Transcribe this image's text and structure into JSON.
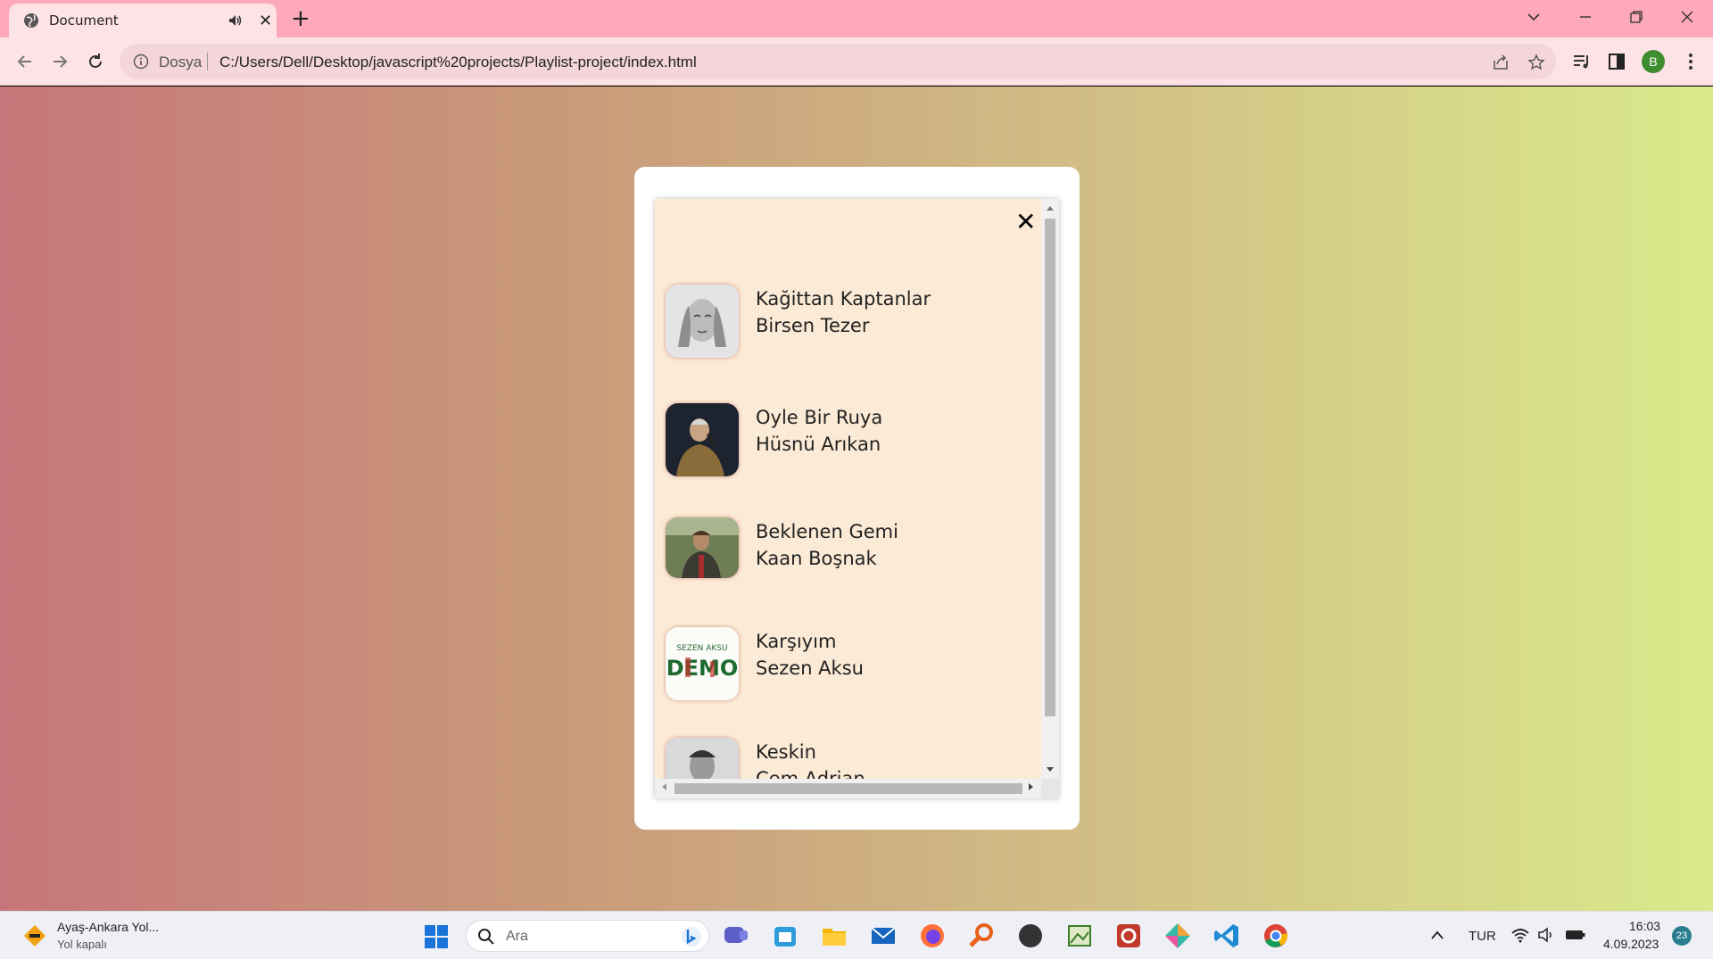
{
  "browser": {
    "tab_title": "Document",
    "new_tab": "+",
    "tab_close": "✕",
    "omnibox_label": "Dosya",
    "url": "C:/Users/Dell/Desktop/javascript%20projects/Playlist-project/index.html",
    "profile_initial": "B"
  },
  "playlist": {
    "close_label": "✕",
    "songs": [
      {
        "name": "Kağittan Kaptanlar",
        "artist": "Birsen Tezer"
      },
      {
        "name": "Oyle Bir Ruya",
        "artist": "Hüsnü Arıkan"
      },
      {
        "name": "Beklenen Gemi",
        "artist": "Kaan Boşnak"
      },
      {
        "name": "Karşıyım",
        "artist": "Sezen Aksu"
      },
      {
        "name": "Keskin",
        "artist": "Cem Adrian"
      }
    ],
    "cover4_text_top": "SEZEN AKSU",
    "cover4_text_main": "DEMO"
  },
  "taskbar": {
    "news_title": "Ayaş-Ankara Yol...",
    "news_subtitle": "Yol kapalı",
    "search_placeholder": "Ara",
    "language": "TUR",
    "time": "16:03",
    "date": "4.09.2023",
    "notification_count": "23"
  }
}
